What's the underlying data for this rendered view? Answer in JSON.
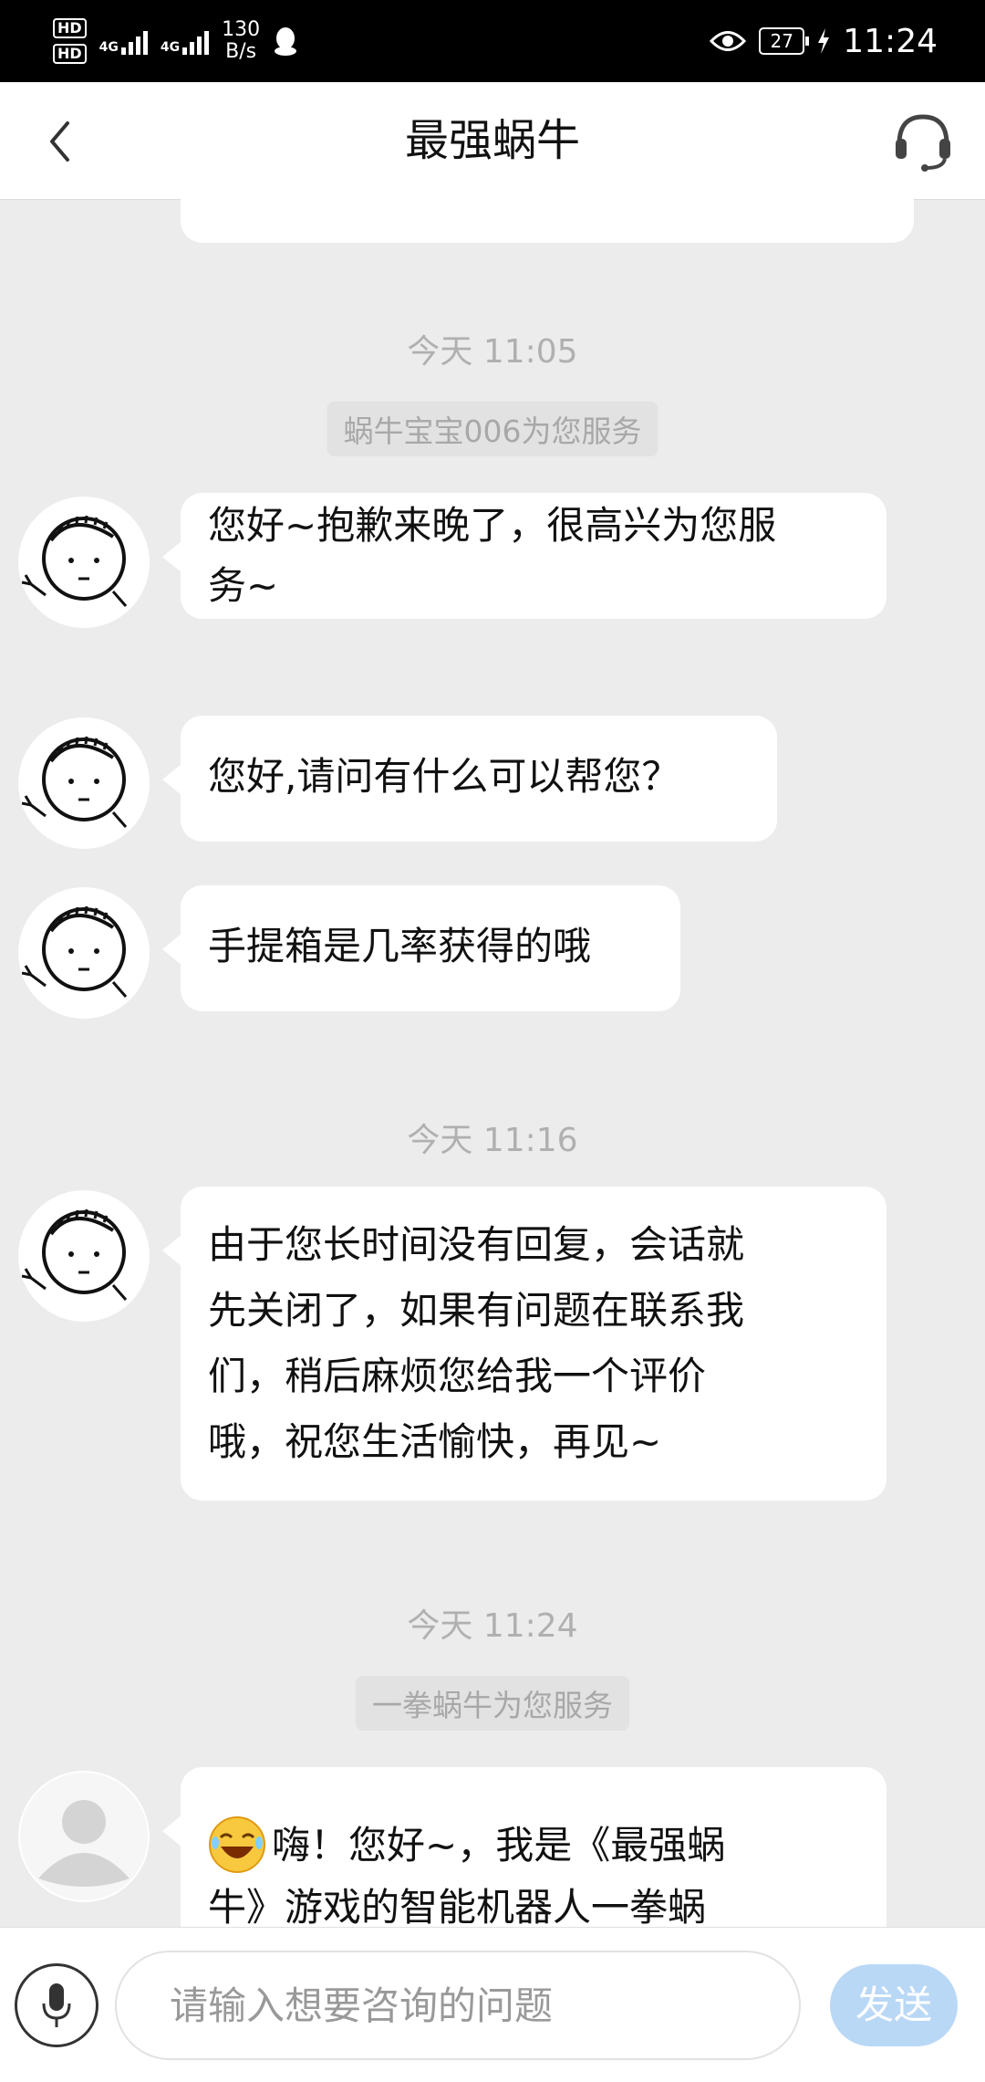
{
  "status_bar": {
    "sim1": "HD",
    "sim2": "HD",
    "net1": "4G",
    "net2": "4G",
    "speed_value": "130",
    "speed_unit": "B/s",
    "battery": "27",
    "time": "11:24",
    "icons": [
      "signal-icon",
      "qq-icon",
      "eye-icon",
      "battery-icon",
      "charging-icon"
    ]
  },
  "header": {
    "title": "最强蜗牛",
    "back_icon": "chevron-left-icon",
    "service_icon": "headset-icon"
  },
  "chat": {
    "timestamps": [
      "今天 11:05",
      "今天 11:16",
      "今天 11:24"
    ],
    "agents": [
      "蜗牛宝宝006为您服务",
      "一拳蜗牛为您服务"
    ],
    "messages": [
      {
        "line1": "您好~抱歉来晚了，很高兴为您服",
        "line2": "务~"
      },
      {
        "line1": "您好,请问有什么可以帮您？"
      },
      {
        "line1": "手提箱是几率获得的哦"
      },
      {
        "line1": "由于您长时间没有回复，会话就",
        "line2": "先关闭了，如果有问题在联系我",
        "line3": "们，稍后麻烦您给我一个评价",
        "line4": "哦，祝您生活愉快，再见~"
      },
      {
        "line1": "嗨！您好~，我是《最强蜗",
        "line2": "牛》游戏的智能机器人一拳蜗"
      }
    ]
  },
  "input_bar": {
    "placeholder": "请输入想要咨询的问题",
    "send_label": "发送",
    "mic_icon": "microphone-icon"
  },
  "colors": {
    "background": "#ececec",
    "bubble": "#ffffff",
    "timestamp": "#b0b0b0",
    "send_button": "#b9d8f6"
  }
}
